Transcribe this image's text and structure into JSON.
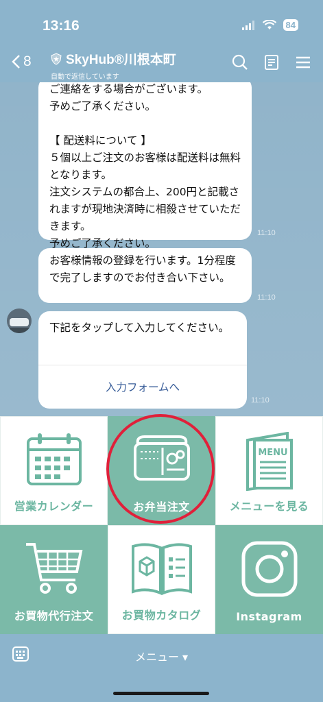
{
  "status": {
    "time": "13:16",
    "battery": "84"
  },
  "header": {
    "back_count": "8",
    "title": "SkyHub®川根本町",
    "subtitle": "自動で返信しています"
  },
  "messages": [
    {
      "text": "ご連絡をする場合がございます。\n予めご了承ください。\n\n【 配送料について 】\n５個以上ご注文のお客様は配送料は無料となります。\n注文システムの都合上、200円と記載されますが現地決済時に相殺させていただきます。\n予めご了承ください。",
      "time": "11:10"
    },
    {
      "text": "お客様情報の登録を行います。1分程度で完了しますのでお付き合い下さい。",
      "time": "11:10"
    },
    {
      "text": "下記をタップして入力してください。",
      "link": "入力フォームへ",
      "time": "11:10"
    }
  ],
  "rich_menu": [
    {
      "label": "営業カレンダー",
      "icon": "calendar-icon"
    },
    {
      "label": "お弁当注文",
      "icon": "bento-icon"
    },
    {
      "label": "メニューを見る",
      "icon": "menu-book-icon",
      "icon_text": "MENU"
    },
    {
      "label": "お買物代行注文",
      "icon": "cart-icon"
    },
    {
      "label": "お買物カタログ",
      "icon": "catalog-icon"
    },
    {
      "label": "Instagram",
      "icon": "instagram-icon"
    }
  ],
  "bottom": {
    "menu_label": "メニュー ▾"
  },
  "colors": {
    "bar": "#8cb4cc",
    "tile_green": "#7bbaa8",
    "highlight": "#e0203a",
    "link": "#3b5f9a"
  }
}
